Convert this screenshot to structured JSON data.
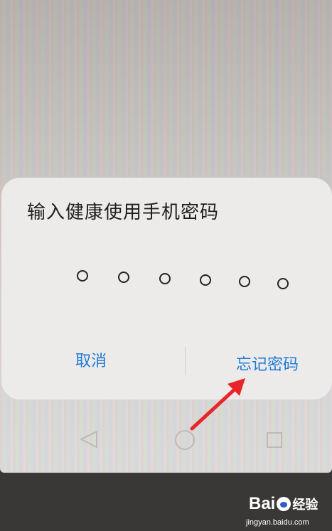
{
  "dialog": {
    "title": "输入健康使用手机密码",
    "pin_length": 6,
    "cancel_label": "取消",
    "forgot_label": "忘记密码"
  },
  "navbar": {
    "buttons": [
      "back-icon",
      "home-icon",
      "recents-icon"
    ]
  },
  "annotation": {
    "arrow_color": "#e8262a"
  },
  "watermark": {
    "brand_prefix": "Bai",
    "brand_suffix": "经验",
    "site": "jingyan.baidu.com"
  },
  "colors": {
    "accent": "#1f7ad6",
    "dialog_bg": "#ecebea"
  }
}
